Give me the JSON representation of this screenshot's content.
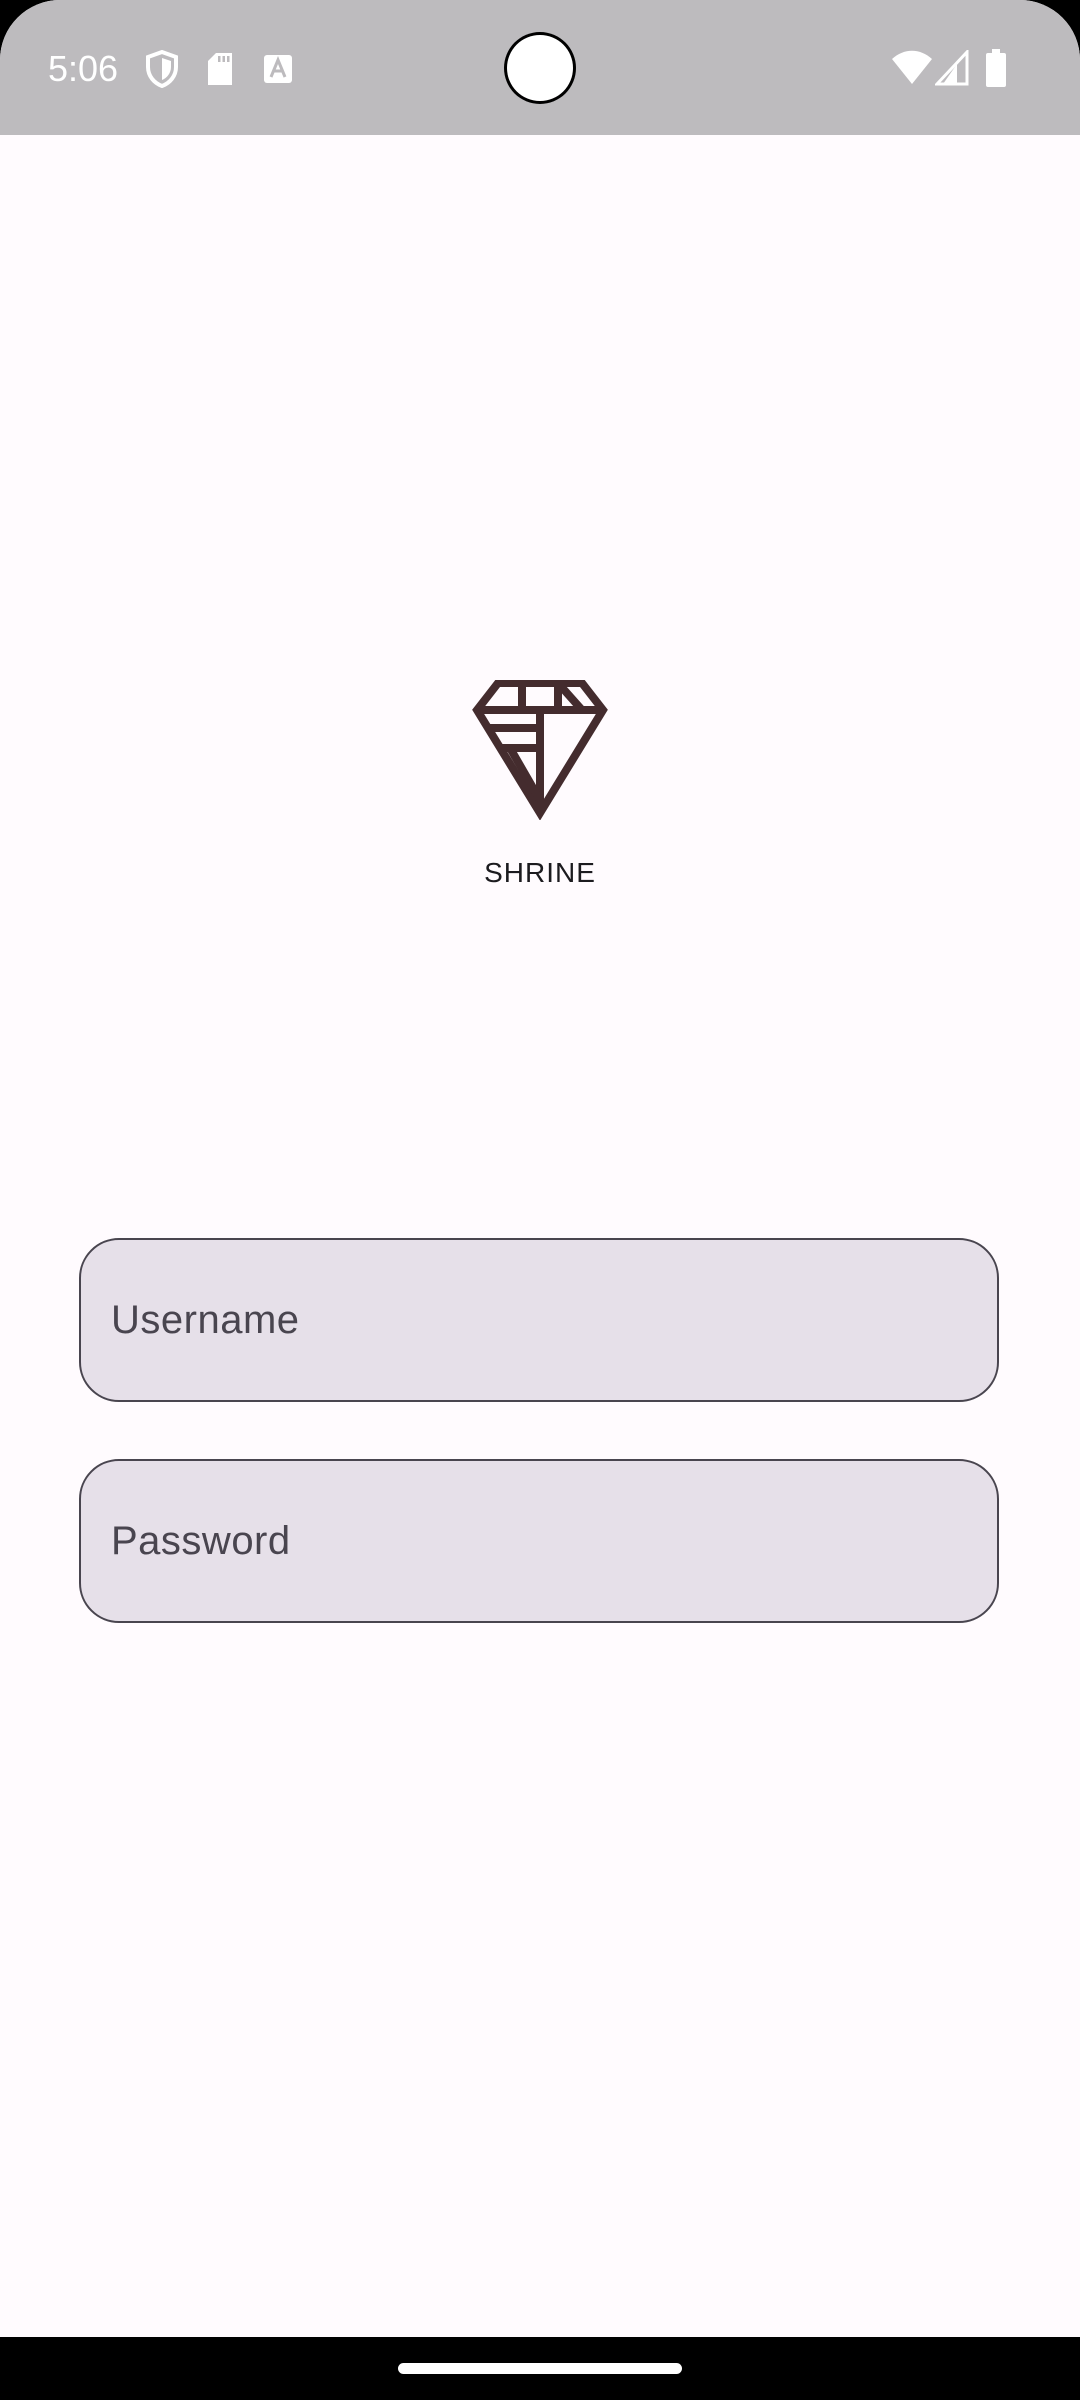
{
  "status_bar": {
    "time": "5:06",
    "left_icons": [
      "shield-icon",
      "sd-card-icon",
      "text-a-icon"
    ],
    "right_icons": [
      "wifi-icon",
      "signal-icon",
      "battery-icon"
    ],
    "background_color": "#bdbbbe"
  },
  "app": {
    "logo_icon": "diamond-logo-icon",
    "name": "SHRINE",
    "logo_color": "#442c2e",
    "background_color": "#fffbfe"
  },
  "form": {
    "username": {
      "label": "Username",
      "value": ""
    },
    "password": {
      "label": "Password",
      "value": ""
    },
    "field_color": "#e6e0e9",
    "border_color": "#49454f"
  },
  "navigation": {
    "home_indicator_icon": "home-indicator-icon"
  }
}
